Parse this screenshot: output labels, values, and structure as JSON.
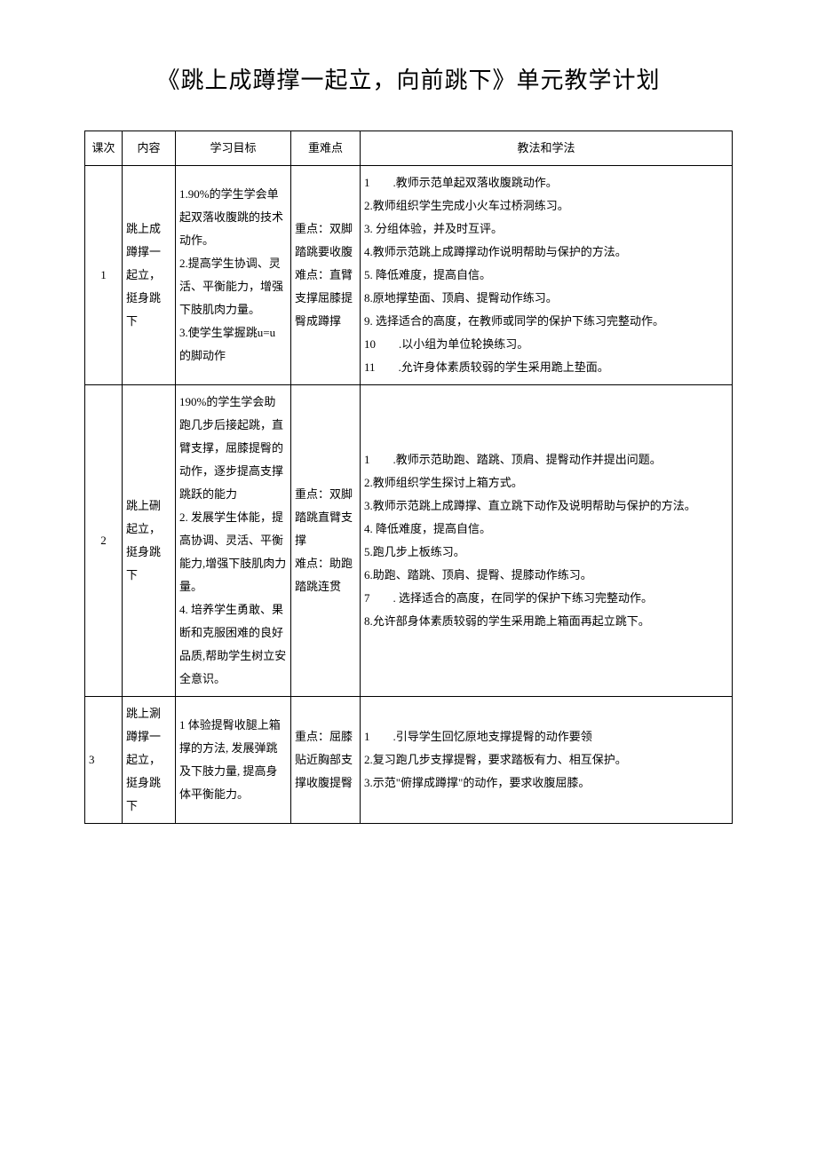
{
  "title": "《跳上成蹲撑一起立，向前跳下》单元教学计划",
  "headers": {
    "col1": "课次",
    "col2": "内容",
    "col3": "学习目标",
    "col4": "重难点",
    "col5": "教法和学法"
  },
  "rows": [
    {
      "no": "1",
      "content": "跳上成蹲撑一起立，挺身跳下",
      "goal": "1.90%的学生学会单起双落收腹跳的技术动作。\n2.提高学生协调、灵活、平衡能力，增强下肢肌肉力量。\n3.使学生掌握跳u=u的脚动作",
      "keypoint": "重点：双脚踏跳要收腹\n难点：直臂支撑屈膝提臀成蹲撑",
      "method": "1　　.教师示范单起双落收腹跳动作。\n2.教师组织学生完成小火车过桥洞练习。\n3. 分组体验，并及时互评。\n4.教师示范跳上成蹲撑动作说明帮助与保护的方法。\n5. 降低难度，提高自信。\n8.原地撑垫面、顶肩、提臀动作练习。\n9. 选择适合的高度，在教师或同学的保护下练习完整动作。\n10　　.以小组为单位轮换练习。\n11　　.允许身体素质较弱的学生采用跪上垫面。"
    },
    {
      "no": "2",
      "content": "跳上硎起立，挺身跳下",
      "goal": "190%的学生学会助跑几步后接起跳，直臂支撑，屈膝提臀的动作，逐步提高支撑跳跃的能力\n2. 发展学生体能，提高协调、灵活、平衡能力,增强下肢肌肉力量。\n4. 培养学生勇敢、果断和克服困难的良好品质,帮助学生树立安全意识。",
      "keypoint": "重点：双脚踏跳直臂支撑\n难点：助跑踏跳连贯",
      "method": "1　　.教师示范助跑、踏跳、顶肩、提臀动作并提出问题。\n2.教师组织学生探讨上箱方式。\n3.教师示范跳上成蹲撑、直立跳下动作及说明帮助与保护的方法。\n4. 降低难度，提高自信。\n5.跑几步上板练习。\n6.助跑、踏跳、顶肩、提臀、提膝动作练习。\n7　　. 选择适合的高度，在同学的保护下练习完整动作。\n8.允许部身体素质较弱的学生采用跪上箱面再起立跳下。"
    },
    {
      "no": "3",
      "content": "跳上涮蹲撑一起立，挺身跳下",
      "goal": "1 体验提臀收腿上箱撑的方法, 发展弹跳及下肢力量, 提高身体平衡能力。",
      "keypoint": "重点：屈膝贴近胸部支撑收腹提臀",
      "method": "1　　.引导学生回忆原地支撑提臀的动作要领\n2.复习跑几步支撑提臀，要求踏板有力、相互保护。\n3.示范\"俯撑成蹲撑\"的动作，要求收腹屈膝。"
    }
  ]
}
